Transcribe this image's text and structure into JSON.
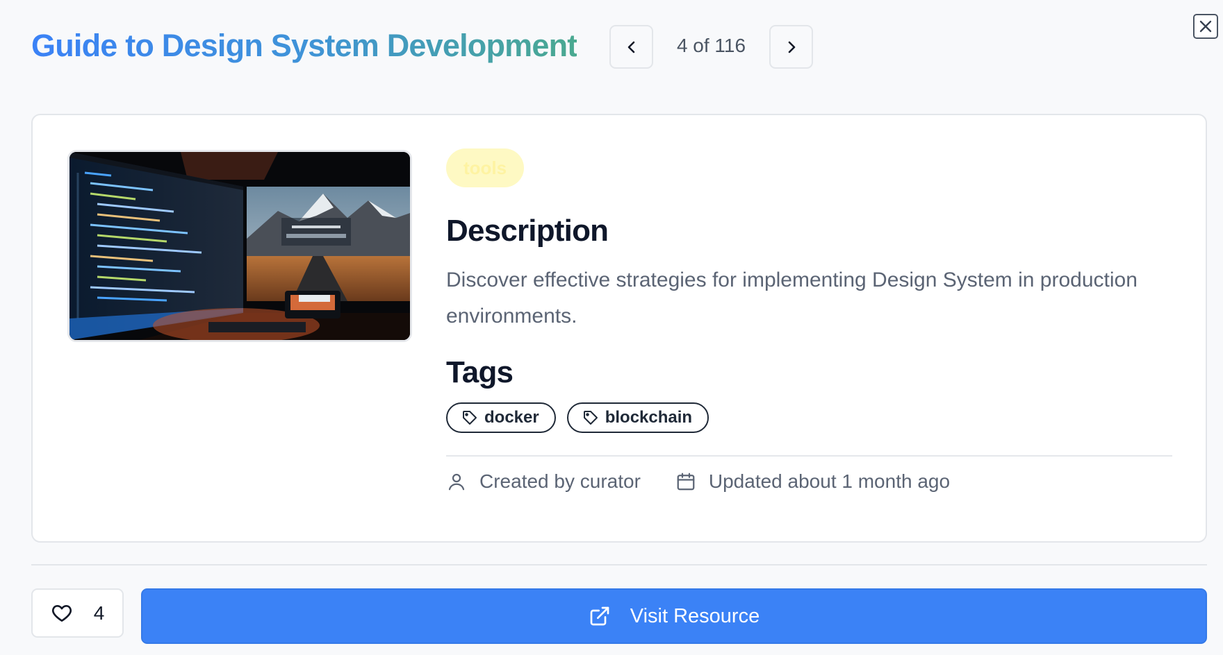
{
  "header": {
    "title": "Guide to Design System Development",
    "counter": "4 of 116",
    "prev_icon": "chevron-left-icon",
    "next_icon": "chevron-right-icon",
    "close_icon": "close-icon"
  },
  "card": {
    "image_description": "code-editor-and-mountain-monitors",
    "category": "tools",
    "description_heading": "Description",
    "description": "Discover effective strategies for implementing Design System in production environments.",
    "tags_heading": "Tags",
    "tags": [
      {
        "label": "docker",
        "icon": "tag-icon"
      },
      {
        "label": "blockchain",
        "icon": "tag-icon"
      }
    ],
    "meta": {
      "created": "Created by curator",
      "created_icon": "user-icon",
      "updated": "Updated about 1 month ago",
      "updated_icon": "calendar-icon"
    }
  },
  "footer": {
    "likes": "4",
    "like_icon": "heart-icon",
    "visit_label": "Visit Resource",
    "visit_icon": "external-link-icon"
  },
  "colors": {
    "title_gradient_start": "#3b82f6",
    "title_gradient_end": "#4aa990",
    "primary": "#3b82f6",
    "category_bg": "#fef9c3"
  }
}
